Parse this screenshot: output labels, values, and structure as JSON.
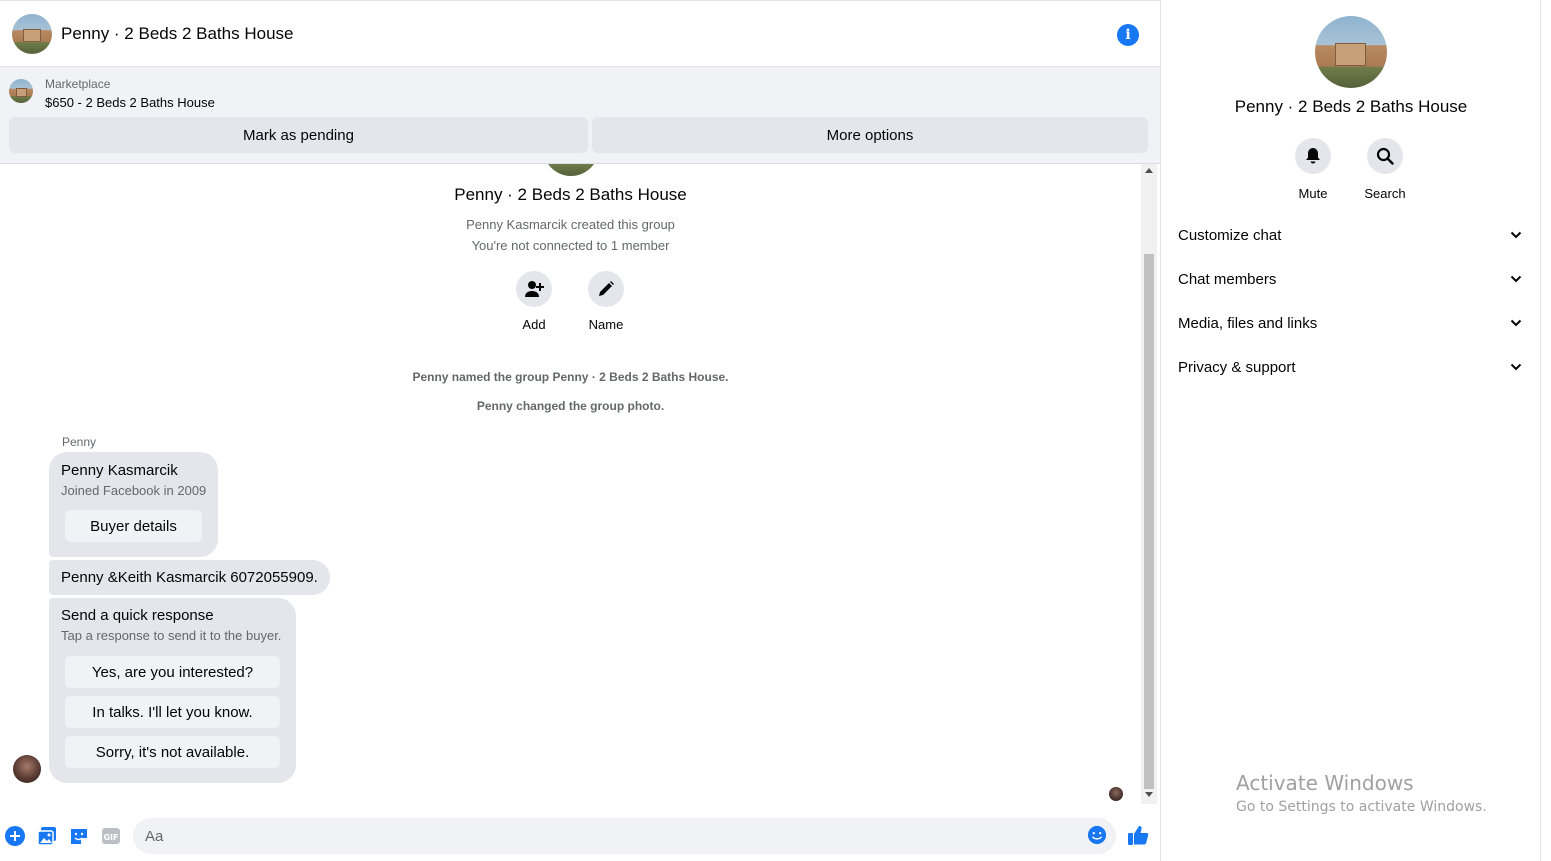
{
  "header": {
    "title": "Penny · 2 Beds 2 Baths House",
    "info_icon": "info-icon"
  },
  "marketplace": {
    "label": "Marketplace",
    "listing": "$650 - 2 Beds 2 Baths House",
    "pending_label": "Mark as pending",
    "options_label": "More options"
  },
  "conversation": {
    "group_name": "Penny · 2 Beds 2 Baths House",
    "created_text": "Penny Kasmarcik created this group",
    "connected_text": "You're not connected to 1 member",
    "actions": [
      {
        "label": "Add",
        "icon": "add-person-icon"
      },
      {
        "label": "Name",
        "icon": "pencil-icon"
      }
    ],
    "renamed_event": "Penny named the group Penny · 2 Beds 2 Baths House.",
    "photo_event": "Penny changed the group photo.",
    "sender": "Penny",
    "buyer_card": {
      "name": "Penny Kasmarcik",
      "joined": "Joined Facebook in 2009",
      "button": "Buyer details"
    },
    "phone_message": "Penny &Keith Kasmarcik 6072055909.",
    "quick_response": {
      "title": "Send a quick response",
      "subtitle": "Tap a response to send it to the buyer.",
      "options": [
        "Yes, are you interested?",
        "In talks. I'll let you know.",
        "Sorry, it's not available."
      ]
    }
  },
  "composer": {
    "placeholder": "Aa",
    "icons": [
      "plus-icon",
      "photo-icon",
      "sticker-icon",
      "gif-icon",
      "emoji-icon",
      "like-icon"
    ]
  },
  "info_panel": {
    "title": "Penny · 2 Beds 2 Baths House",
    "actions": [
      {
        "label": "Mute",
        "icon": "bell-icon"
      },
      {
        "label": "Search",
        "icon": "search-icon"
      }
    ],
    "sections": [
      "Customize chat",
      "Chat members",
      "Media, files and links",
      "Privacy & support"
    ]
  },
  "watermark": {
    "title": "Activate Windows",
    "subtitle": "Go to Settings to activate Windows."
  },
  "colors": {
    "accent": "#1877f2",
    "bubble": "#e4e6eb",
    "secondary_text": "#65676b"
  }
}
